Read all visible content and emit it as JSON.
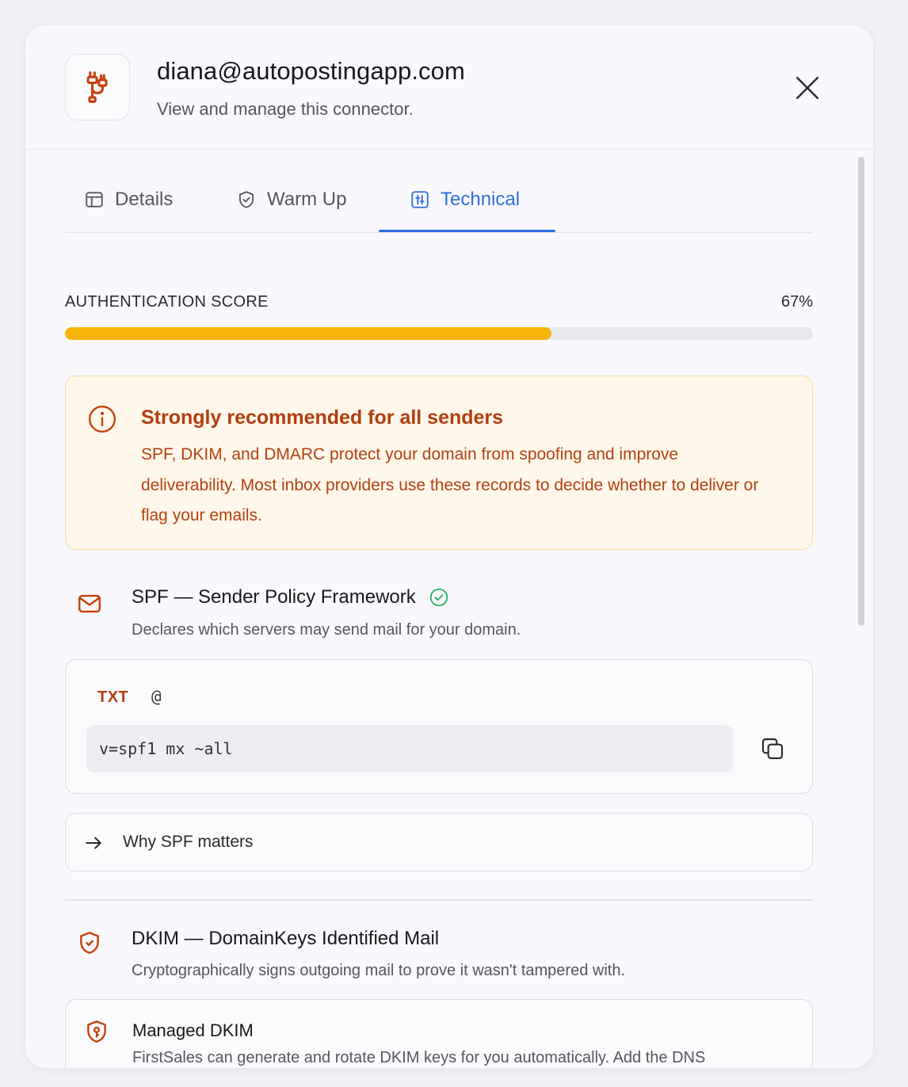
{
  "header": {
    "title": "diana@autopostingapp.com",
    "subtitle": "View and manage this connector.",
    "app_icon": "plug-connector-icon",
    "close_icon": "close-icon"
  },
  "tabs": [
    {
      "label": "Details",
      "icon": "layout-icon",
      "active": false
    },
    {
      "label": "Warm Up",
      "icon": "shield-check-icon",
      "active": false
    },
    {
      "label": "Technical",
      "icon": "settings-sliders-icon",
      "active": true
    }
  ],
  "score": {
    "label": "AUTHENTICATION SCORE",
    "value_text": "67%",
    "fraction": 0.65
  },
  "alert": {
    "title": "Strongly recommended for all senders",
    "body": "SPF, DKIM, and DMARC protect your domain from spoofing and improve deliverability. Most inbox providers use these records to decide whether to deliver or flag your emails."
  },
  "spf": {
    "title": "SPF — Sender Policy Framework",
    "description": "Declares which servers may send mail for your domain.",
    "status": "verified",
    "record": {
      "type": "TXT",
      "host": "@",
      "value": "v=spf1 mx ~all"
    },
    "why_label": "Why SPF matters"
  },
  "dkim": {
    "title": "DKIM — DomainKeys Identified Mail",
    "description": "Cryptographically signs outgoing mail to prove it wasn't tampered with.",
    "managed": {
      "title": "Managed DKIM",
      "description": "FirstSales can generate and rotate DKIM keys for you automatically. Add the DNS record below once and we handle the rest."
    }
  },
  "colors": {
    "accent": "#2f6fe0",
    "warning": "#b23d0f",
    "progress": "#f5b50a",
    "success": "#2fb36a"
  }
}
